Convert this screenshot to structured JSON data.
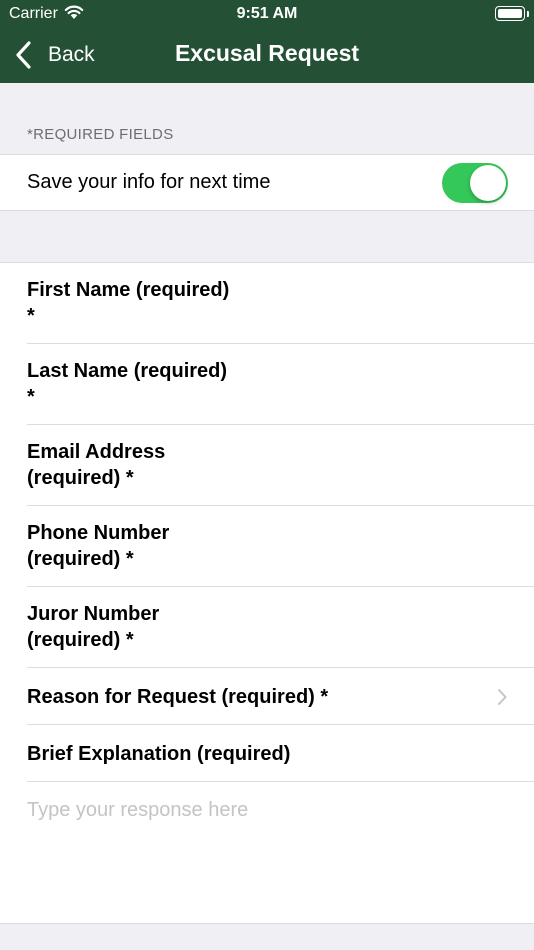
{
  "status_bar": {
    "carrier": "Carrier",
    "time": "9:51 AM"
  },
  "nav": {
    "back_label": "Back",
    "title": "Excusal Request"
  },
  "section": {
    "required_note": "*REQUIRED FIELDS"
  },
  "save_info": {
    "label": "Save your info for next time",
    "enabled": true
  },
  "fields": [
    {
      "label": "First Name (required)\n*"
    },
    {
      "label": "Last Name (required)\n*"
    },
    {
      "label": "Email Address\n(required) *"
    },
    {
      "label": "Phone Number\n(required) *"
    },
    {
      "label": "Juror Number\n(required) *"
    },
    {
      "label": "Reason for Request (required) *"
    },
    {
      "label": "Brief Explanation (required)"
    }
  ],
  "explanation": {
    "placeholder": "Type your response here"
  },
  "colors": {
    "header": "#245035",
    "toggle_on": "#34c759"
  }
}
